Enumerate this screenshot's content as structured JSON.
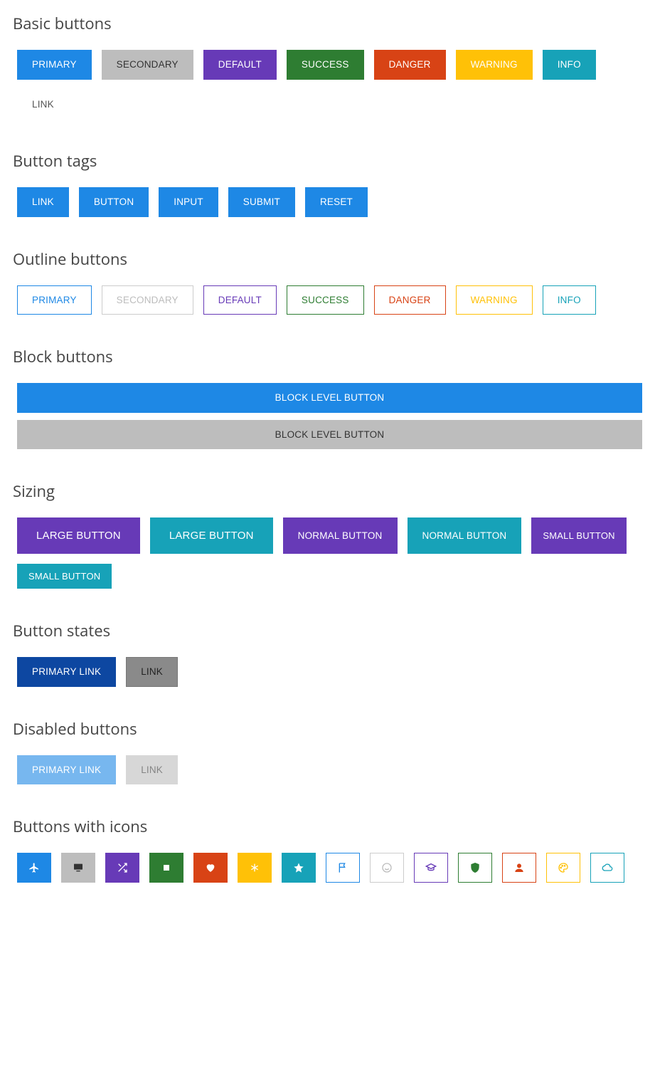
{
  "sections": {
    "basic": {
      "title": "Basic buttons"
    },
    "tags": {
      "title": "Button tags"
    },
    "outline": {
      "title": "Outline buttons"
    },
    "block": {
      "title": "Block buttons"
    },
    "sizing": {
      "title": "Sizing"
    },
    "states": {
      "title": "Button states"
    },
    "disabled": {
      "title": "Disabled buttons"
    },
    "icons": {
      "title": "Buttons with icons"
    }
  },
  "basic_buttons": [
    {
      "label": "PRIMARY",
      "variant": "primary"
    },
    {
      "label": "SECONDARY",
      "variant": "secondary"
    },
    {
      "label": "DEFAULT",
      "variant": "default"
    },
    {
      "label": "SUCCESS",
      "variant": "success"
    },
    {
      "label": "DANGER",
      "variant": "danger"
    },
    {
      "label": "WARNING",
      "variant": "warning"
    },
    {
      "label": "INFO",
      "variant": "info"
    },
    {
      "label": "LINK",
      "variant": "link"
    }
  ],
  "tag_buttons": [
    {
      "label": "LINK"
    },
    {
      "label": "BUTTON"
    },
    {
      "label": "INPUT"
    },
    {
      "label": "SUBMIT"
    },
    {
      "label": "RESET"
    }
  ],
  "outline_buttons": [
    {
      "label": "PRIMARY",
      "variant": "primary"
    },
    {
      "label": "SECONDARY",
      "variant": "secondary"
    },
    {
      "label": "DEFAULT",
      "variant": "default"
    },
    {
      "label": "SUCCESS",
      "variant": "success"
    },
    {
      "label": "DANGER",
      "variant": "danger"
    },
    {
      "label": "WARNING",
      "variant": "warning"
    },
    {
      "label": "INFO",
      "variant": "info"
    }
  ],
  "block_buttons": [
    {
      "label": "BLOCK LEVEL BUTTON",
      "variant": "primary"
    },
    {
      "label": "BLOCK LEVEL BUTTON",
      "variant": "secondary"
    }
  ],
  "sizing_buttons": [
    {
      "label": "LARGE BUTTON",
      "variant": "default",
      "size": "lg"
    },
    {
      "label": "LARGE BUTTON",
      "variant": "info",
      "size": "lg"
    },
    {
      "label": "NORMAL BUTTON",
      "variant": "default",
      "size": "md"
    },
    {
      "label": "NORMAL BUTTON",
      "variant": "info",
      "size": "md"
    },
    {
      "label": "SMALL BUTTON",
      "variant": "default",
      "size": "sm"
    },
    {
      "label": "SMALL BUTTON",
      "variant": "info",
      "size": "sm"
    }
  ],
  "state_buttons": [
    {
      "label": "PRIMARY LINK",
      "variant": "primary"
    },
    {
      "label": "LINK",
      "variant": "secondary"
    }
  ],
  "disabled_buttons": [
    {
      "label": "PRIMARY LINK",
      "variant": "primary"
    },
    {
      "label": "LINK",
      "variant": "secondary"
    }
  ],
  "icon_buttons": [
    {
      "icon": "plane",
      "variant": "primary",
      "outline": false
    },
    {
      "icon": "display",
      "variant": "secondary",
      "outline": false
    },
    {
      "icon": "shuffle",
      "variant": "default",
      "outline": false
    },
    {
      "icon": "square",
      "variant": "success",
      "outline": false
    },
    {
      "icon": "heart",
      "variant": "danger",
      "outline": false
    },
    {
      "icon": "asterisk",
      "variant": "warning",
      "outline": false
    },
    {
      "icon": "star",
      "variant": "info",
      "outline": false
    },
    {
      "icon": "flag",
      "variant": "primary",
      "outline": true
    },
    {
      "icon": "smile",
      "variant": "secondary",
      "outline": true
    },
    {
      "icon": "graduation",
      "variant": "default",
      "outline": true
    },
    {
      "icon": "shield",
      "variant": "success",
      "outline": true
    },
    {
      "icon": "user",
      "variant": "danger",
      "outline": true
    },
    {
      "icon": "palette",
      "variant": "warning",
      "outline": true
    },
    {
      "icon": "cloud",
      "variant": "info",
      "outline": true
    }
  ],
  "colors": {
    "primary": "#1e88e5",
    "secondary": "#bdbdbd",
    "default": "#673ab7",
    "success": "#2e7d32",
    "danger": "#d84315",
    "warning": "#ffc107",
    "info": "#17a2b8"
  }
}
